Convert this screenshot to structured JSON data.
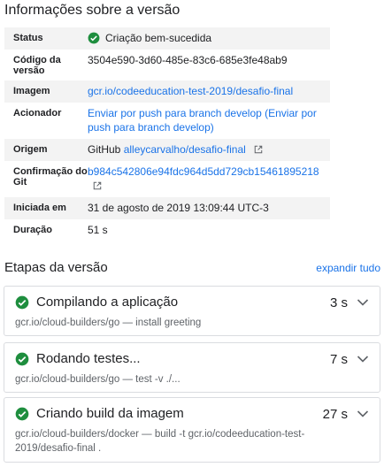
{
  "info": {
    "title": "Informações sobre a versão",
    "rows": {
      "status": {
        "key": "Status",
        "value": "Criação bem-sucedida"
      },
      "version_code": {
        "key": "Código da versão",
        "value": "3504e590-3d60-485e-83c6-685e3fe48ab9"
      },
      "image": {
        "key": "Imagem",
        "value": "gcr.io/codeeducation-test-2019/desafio-final"
      },
      "trigger": {
        "key": "Acionador",
        "value": "Enviar por push para branch develop (Enviar por push para branch develop)"
      },
      "origin": {
        "key": "Origem",
        "prefix": "GitHub",
        "link": "alleycarvalho/desafio-final"
      },
      "git_commit": {
        "key": "Confirmação do Git",
        "value": "b984c542806e94fdc964d5dd729cb15461895218"
      },
      "started": {
        "key": "Iniciada em",
        "value": "31 de agosto de 2019 13:09:44 UTC-3"
      },
      "duration": {
        "key": "Duração",
        "value": "51 s"
      }
    }
  },
  "steps_section": {
    "title": "Etapas da versão",
    "expand_all": "expandir tudo",
    "steps": [
      {
        "name": "Compilando a aplicação",
        "duration": "3 s",
        "description": "gcr.io/cloud-builders/go — install greeting"
      },
      {
        "name": "Rodando testes...",
        "duration": "7 s",
        "description": "gcr.io/cloud-builders/go — test -v ./..."
      },
      {
        "name": "Criando build da imagem",
        "duration": "27 s",
        "description": "gcr.io/cloud-builders/docker — build -t gcr.io/codeeducation-test-2019/desafio-final ."
      }
    ]
  },
  "colors": {
    "success": "#1e8e3e",
    "link": "#1a73e8",
    "row_alt": "#f3f3f3"
  },
  "icons": {
    "status": "check-circle-icon",
    "external": "external-link-icon",
    "expand": "chevron-down-icon"
  }
}
